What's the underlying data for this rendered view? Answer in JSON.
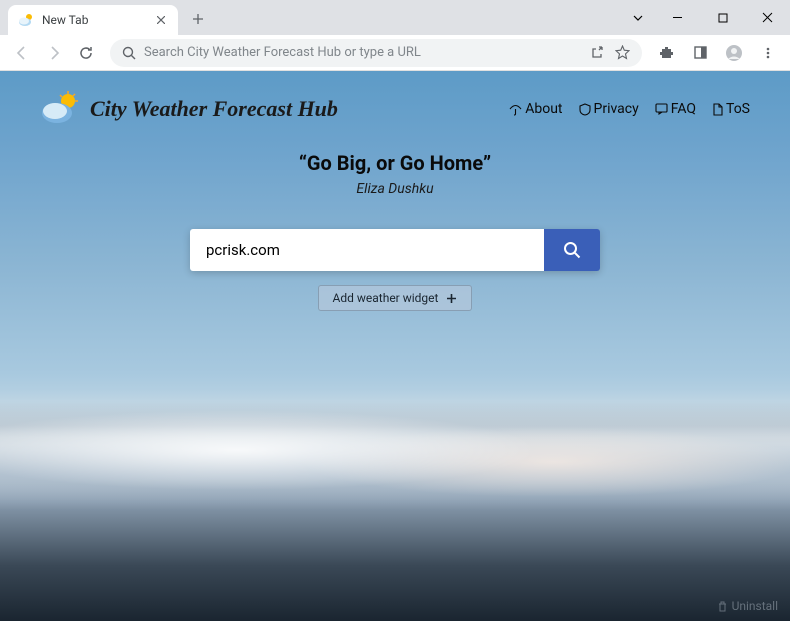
{
  "browser": {
    "tab_title": "New Tab",
    "omnibox_placeholder": "Search City Weather Forecast Hub or type a URL"
  },
  "header": {
    "site_title": "City Weather Forecast Hub",
    "nav": {
      "about": "About",
      "privacy": "Privacy",
      "faq": "FAQ",
      "tos": "ToS"
    }
  },
  "quote": {
    "text": "“Go Big, or Go Home”",
    "author": "Eliza Dushku"
  },
  "search": {
    "value": "pcrisk.com"
  },
  "widget_button": "Add weather widget",
  "footer": {
    "uninstall": "Uninstall"
  }
}
